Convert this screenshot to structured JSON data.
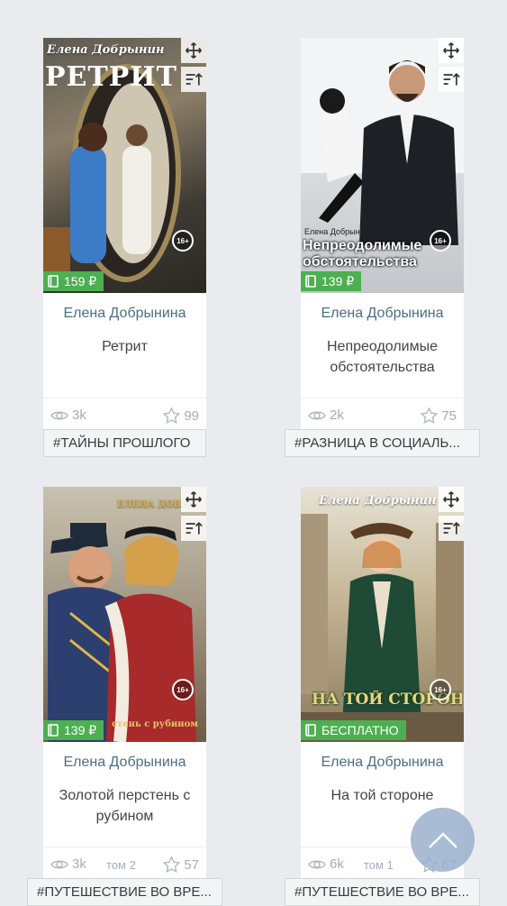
{
  "books": [
    {
      "cover_author": "Елена Добрынин",
      "cover_title": "РЕТРИТ",
      "age_rating": "16+",
      "price": "159 ₽",
      "author": "Елена Добрынина",
      "title": "Ретрит",
      "views": "3k",
      "volume": "",
      "rating": "99",
      "tag": "#ТАЙНЫ ПРОШЛОГО"
    },
    {
      "cover_author": "Елена Добрынина",
      "cover_title": "Непреодолимые обстоятельства",
      "age_rating": "16+",
      "price": "139 ₽",
      "author": "Елена Добрынина",
      "title": "Непреодолимые обстоятельства",
      "views": "2k",
      "volume": "",
      "rating": "75",
      "tag": "#РАЗНИЦА В СОЦИАЛЬ..."
    },
    {
      "cover_author": "ЕЛЕНА ДОБРЫ",
      "cover_title": "стень с рубином",
      "age_rating": "16+",
      "price": "139 ₽",
      "author": "Елена Добрынина",
      "title": "Золотой перстень с рубином",
      "views": "3k",
      "volume": "том 2",
      "rating": "57",
      "tag": "#ПУТЕШЕСТВИЕ ВО ВРЕ..."
    },
    {
      "cover_author": "Елена Добрынин",
      "cover_title": "НА ТОЙ СТОРОНЕ",
      "age_rating": "16+",
      "price": "БЕСПЛАТНО",
      "author": "Елена Добрынина",
      "title": "На той стороне",
      "views": "6k",
      "volume": "том 1",
      "rating": "67",
      "tag": "#ПУТЕШЕСТВИЕ ВО ВРЕ..."
    }
  ],
  "colors": {
    "price_badge": "#4caf50",
    "author_link": "#4c6e83",
    "scroll_top": "#9ab0cd"
  }
}
